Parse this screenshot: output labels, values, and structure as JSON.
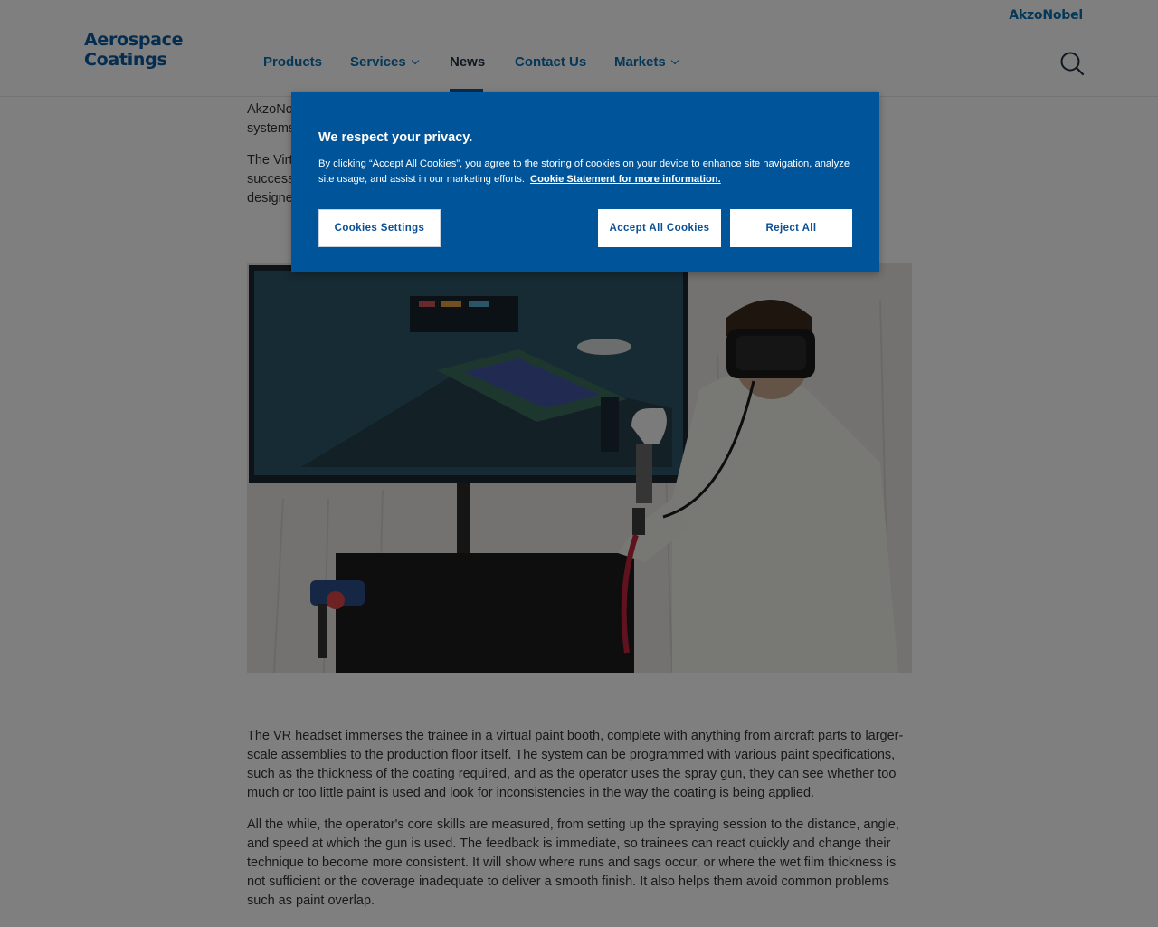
{
  "header": {
    "logo_line1": "Aerospace",
    "logo_line2": "Coatings",
    "brand": "AkzoNobel",
    "nav": [
      {
        "label": "Products"
      },
      {
        "label": "Services"
      },
      {
        "label": "News"
      },
      {
        "label": "Contact Us"
      },
      {
        "label": "Markets"
      }
    ],
    "active_nav": "News",
    "search_icon": "search-icon"
  },
  "article": {
    "p1_visible": "AkzoNo\nsystems",
    "p2_visible": "The Virt\nsuccess\ndesigne",
    "p3": "The VR headset immerses the trainee in a virtual paint booth, complete with anything from aircraft parts to larger-scale assemblies to the production floor itself. The system can be programmed with various paint specifications, such as the thickness of the coating required, and as the operator uses the spray gun, they can see whether too much or too little paint is used and look for inconsistencies in the way the coating is being applied.",
    "p4": "All the while, the operator's core skills are measured, from setting up the spraying session to the distance, angle, and speed at which the gun is used. The feedback is immediate, so trainees can react quickly and change their technique to become more consistent. It will show where runs and sags occur, or where the wet film thickness is not sufficient or the coverage inadequate to deliver a smooth finish. It also helps them avoid common problems such as paint overlap."
  },
  "cookie_banner": {
    "title": "We respect your privacy.",
    "text": "By clicking “Accept All Cookies”, you agree to the storing of cookies on your device to enhance site navigation, analyze site usage, and assist in our marketing efforts.",
    "link": "Cookie Statement for more information.",
    "settings_label": "Cookies Settings",
    "accept_label": "Accept All Cookies",
    "reject_label": "Reject All"
  },
  "colors": {
    "brand_blue": "#0a6fb0",
    "banner_blue": "#005499",
    "overlay": "rgba(0,0,0,0.5)"
  }
}
